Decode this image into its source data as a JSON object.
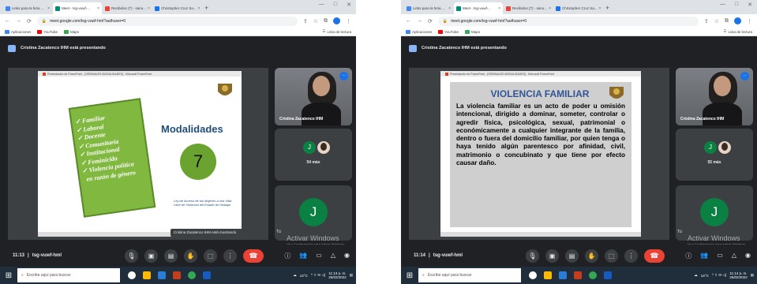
{
  "browser": {
    "tabs": [
      "Links para la feria ...",
      "Meet - tsg-vuwf-...",
      "Recibidos (7) - sano...",
      "Christopher Cruz Sa..."
    ],
    "url": "meet.google.com/tsg-vuwf-hml?authuser=0",
    "bookmarks": [
      "Aplicaciones",
      "YouTube",
      "Maps"
    ],
    "reading_list": "Lista de lectura"
  },
  "left": {
    "presenting": "Cristina Zacatenco IHM está presentando",
    "ppt_title": "Presentación de PowerPoint - [ORDINALES MODALIDADES] - Microsoft PowerPoint",
    "slide": {
      "heading": "Modalidades",
      "number": "7",
      "items": [
        "Familiar",
        "Laboral",
        "Docente",
        "Comunitaria",
        "Institucional",
        "Feminicida",
        "Violencia política",
        "en razón de género"
      ],
      "law": "Ley de Acceso de las Mujeres a una Vida Libre de Violencia del Estado de Hidalgo"
    },
    "tooltip": "Cristina Zacatenco IHM está mostrando",
    "cam_name": "Cristina Zacatenco IHM",
    "others_count": "54 más",
    "big_initial": "J",
    "tu_label": "Tú",
    "activate_title": "Activar Windows",
    "activate_sub": "Ve a Configuración para activar Windows.",
    "time": "11:13",
    "meeting_code": "tsg-vuwf-hml",
    "clock_time": "11:13 a. m.",
    "clock_date": "25/02/2022",
    "temp": "14°C"
  },
  "right": {
    "presenting": "Cristina Zacatenco IHM está presentando",
    "ppt_title": "Presentación de PowerPoint - [ORDINALES MODALIDADES] - Microsoft PowerPoint",
    "slide": {
      "title": "VIOLENCIA FAMILIAR",
      "body": "La violencia familiar es un acto de poder u omisión intencional, dirigido a dominar, someter, controlar o agredir física, psicológica, sexual, patrimonial o económicamente a cualquier integrante de la familia, dentro o fuera del domicilio familiar, por quien tenga o haya tenido algún parentesco por afinidad, civil, matrimonio o concubinato y que tiene por efecto causar daño."
    },
    "cam_name": "Cristina Zacatenco IHM",
    "others_count": "55 más",
    "big_initial": "J",
    "tu_label": "Tú",
    "activate_title": "Activar Windows",
    "activate_sub": "Ve a Configuración para activar Windows.",
    "time": "11:14",
    "meeting_code": "tsg-vuwf-hml",
    "clock_time": "11:14 a. m.",
    "clock_date": "25/02/2022",
    "temp": "14°C"
  },
  "taskbar": {
    "search_placeholder": "Escribe aquí para buscar"
  },
  "icons": [
    "windows-icon",
    "search-icon",
    "mic-icon",
    "camera-icon",
    "captions-icon",
    "raise-hand-icon",
    "present-icon",
    "more-icon",
    "end-call-icon",
    "info-icon",
    "people-icon",
    "chat-icon",
    "activities-icon",
    "lock-icon"
  ]
}
